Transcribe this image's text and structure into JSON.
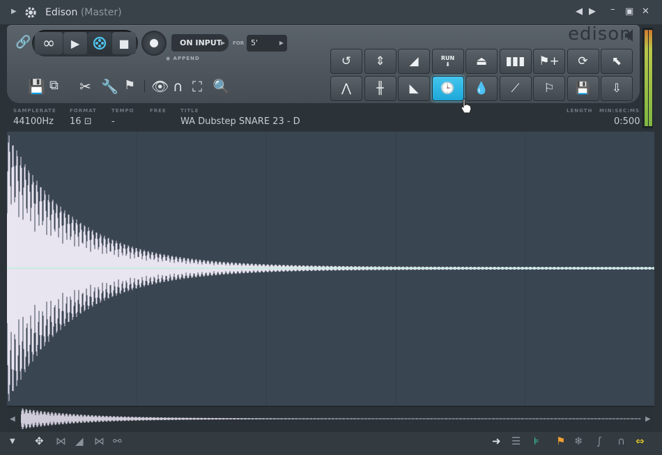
{
  "window": {
    "title": "Edison",
    "title_suffix": "(Master)"
  },
  "toolbar": {
    "loop_icon": "infinity-icon",
    "on_input_label": "ON INPUT",
    "for_label": "FOR",
    "for_value": "5'",
    "append_label": "APPEND",
    "brand": "edison"
  },
  "grid_tools": {
    "run_label": "RUN"
  },
  "info": {
    "samplerate_label": "SAMPLERATE",
    "samplerate_value": "44100Hz",
    "format_label": "FORMAT",
    "format_value": "16",
    "tempo_label": "TEMPO",
    "tempo_value": "-",
    "free_label": "FREE",
    "title_label": "TITLE",
    "title_value": "WA Dubstep SNARE 23 - D",
    "length_label": "LENGTH",
    "time_unit_label": "MIN:SEC:MS",
    "length_value": "0:500"
  },
  "colors": {
    "accent": "#2cb8ea",
    "wave": "#e8e4f0",
    "background": "#3a4552"
  }
}
